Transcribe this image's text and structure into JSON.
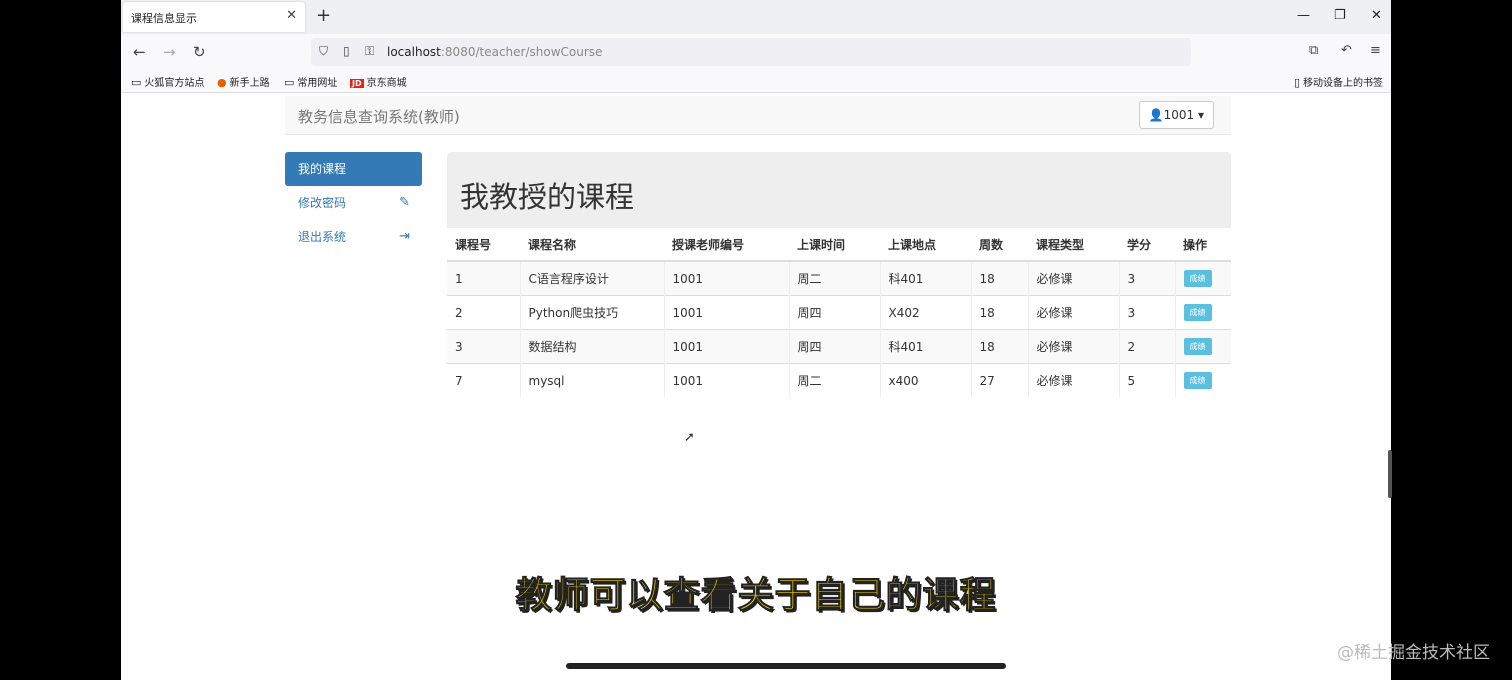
{
  "browser": {
    "tab_title": "课程信息显示",
    "url_prefix": "localhost",
    "url_rest": ":8080/teacher/showCourse",
    "bookmarks": [
      "火狐官方站点",
      "新手上路",
      "常用网址",
      "京东商城"
    ],
    "mobile_bookmarks": "移动设备上的书签",
    "jd_badge": "JD"
  },
  "navbar": {
    "brand": "教务信息查询系统(教师)",
    "user": "1001"
  },
  "sidebar": {
    "items": [
      {
        "label": "我的课程"
      },
      {
        "label": "修改密码"
      },
      {
        "label": "退出系统"
      }
    ]
  },
  "main": {
    "heading": "我教授的课程",
    "columns": [
      "课程号",
      "课程名称",
      "授课老师编号",
      "上课时间",
      "上课地点",
      "周数",
      "课程类型",
      "学分",
      "操作"
    ],
    "rows": [
      [
        "1",
        "C语言程序设计",
        "1001",
        "周二",
        "科401",
        "18",
        "必修课",
        "3"
      ],
      [
        "2",
        "Python爬虫技巧",
        "1001",
        "周四",
        "X402",
        "18",
        "必修课",
        "3"
      ],
      [
        "3",
        "数据结构",
        "1001",
        "周四",
        "科401",
        "18",
        "必修课",
        "2"
      ],
      [
        "7",
        "mysql",
        "1001",
        "周二",
        "x400",
        "27",
        "必修课",
        "5"
      ]
    ],
    "action_label": "成绩"
  },
  "overlay": {
    "subtitle": "教师可以查看关于自己的课程",
    "watermark": "@稀土掘金技术社区"
  }
}
